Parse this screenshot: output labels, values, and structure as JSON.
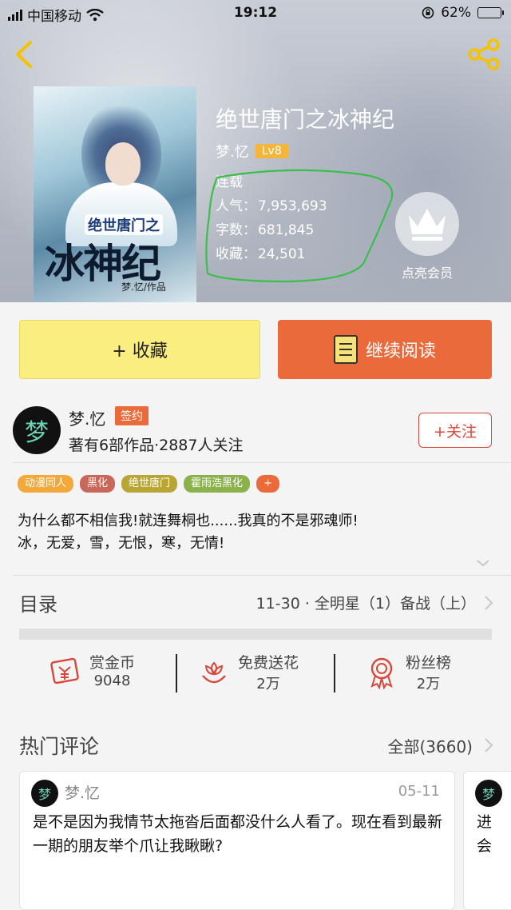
{
  "status_bar": {
    "carrier": "中国移动",
    "time": "19:12",
    "battery": "62%",
    "battery_level": 0.62
  },
  "book": {
    "title": "绝世唐门之冰神纪",
    "author": "梦.忆",
    "level": "Lv8",
    "status": "连载",
    "popularity_label": "人气：",
    "popularity": "7,953,693",
    "words_label": "字数：",
    "words": "681,845",
    "favorites_label": "收藏：",
    "favorites": "24,501",
    "vip_label": "点亮会员"
  },
  "cover": {
    "subtitle": "绝世唐门之",
    "title": "冰神纪",
    "author": "梦.忆/作品"
  },
  "actions": {
    "collect_label": "+ 收藏",
    "read_label": "继续阅读"
  },
  "author_card": {
    "avatar_text": "梦",
    "name": "梦.忆",
    "sign_badge": "签约",
    "works": "著有6部作品·2887人关注",
    "follow_label": "+关注"
  },
  "tags": [
    {
      "label": "动漫同人",
      "color": "#f3a93a"
    },
    {
      "label": "黑化",
      "color": "#c9685a"
    },
    {
      "label": "绝世唐门",
      "color": "#b8a534"
    },
    {
      "label": "霍雨浩黑化",
      "color": "#8bb24a"
    },
    {
      "label": "+",
      "color": "#ea6a3c"
    }
  ],
  "description": {
    "line1": "为什么都不相信我!就连舞桐也......我真的不是邪魂师!",
    "line2": "冰，无爱，雪，无恨，寒，无情!"
  },
  "toc": {
    "title": "目录",
    "latest": "11-30 · 全明星（1）备战（上）"
  },
  "gifts": [
    {
      "label": "赏金币",
      "value": "9048",
      "icon": "money-envelope-icon"
    },
    {
      "label": "免费送花",
      "value": "2万",
      "icon": "flower-icon"
    },
    {
      "label": "粉丝榜",
      "value": "2万",
      "icon": "medal-icon"
    }
  ],
  "hot_comments": {
    "title": "热门评论",
    "all_label": "全部(3660)"
  },
  "comments": [
    {
      "user": "梦.忆",
      "date": "05-11",
      "text": "是不是因为我情节太拖沓后面都没什么人看了。现在看到最新一期的朋友举个爪让我瞅瞅?"
    },
    {
      "text": "进会"
    }
  ],
  "colors": {
    "accent": "#ea6a3c",
    "collect_bg": "#fbee80",
    "level_badge": "#f3b63a",
    "highlight": "#3bbf4a"
  }
}
